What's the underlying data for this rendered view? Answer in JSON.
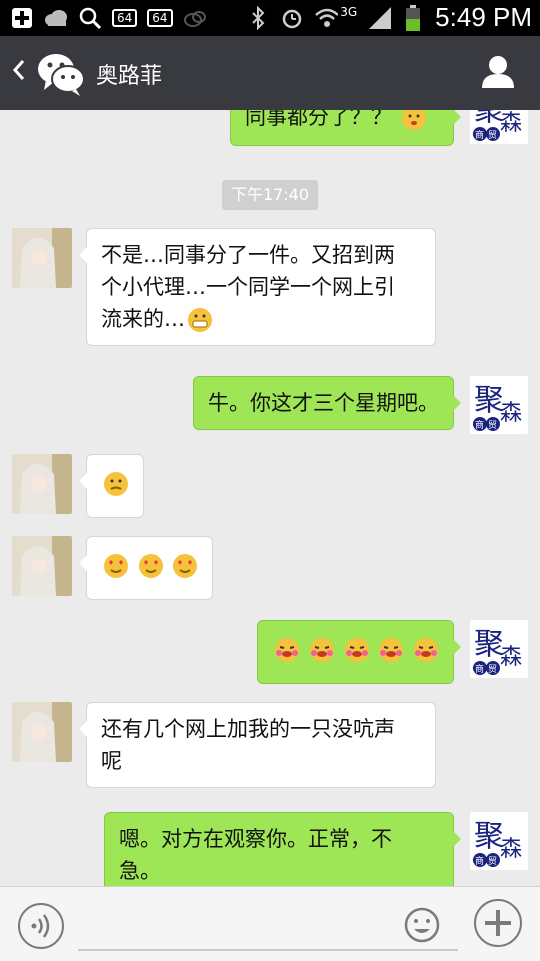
{
  "status": {
    "time": "5:49 PM",
    "badge_64_a": "64",
    "badge_64_b": "64",
    "network": "3G"
  },
  "header": {
    "title": "奥路菲"
  },
  "messages": {
    "m0": "同事都分了？？",
    "ts1": "下午17:40",
    "m1_line1": "不是…同事分了一件。又招到两",
    "m1_line2": "个小代理…一个同学一个网上引",
    "m1_line3": "流来的…",
    "m2": "牛。你这才三个星期吧。",
    "m6_line1": "还有几个网上加我的一只没吭声",
    "m6_line2": "呢",
    "m7_line1": "嗯。对方在观察你。正常，不",
    "m7_line2": "急。"
  },
  "logo": {
    "char_big": "聚",
    "char_small": "森",
    "char_c1": "商",
    "char_c2": "贸"
  },
  "colors": {
    "header_bg": "#393a3f",
    "bubble_out": "#9fe657",
    "bubble_in": "#ffffff",
    "chat_bg": "#ebebeb",
    "logo_blue": "#1a237e"
  }
}
